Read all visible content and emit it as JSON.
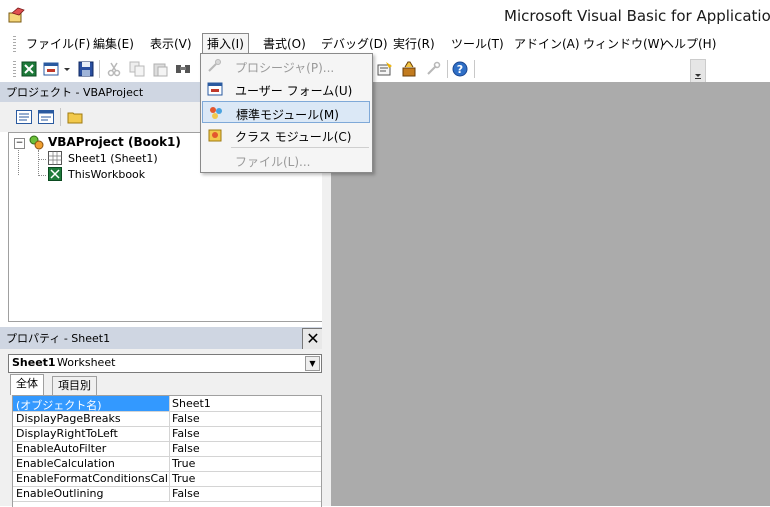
{
  "window": {
    "title": "Microsoft Visual Basic for Applications",
    "app_icon": "vba-window-icon"
  },
  "menu": [
    {
      "label": "ファイル(F)"
    },
    {
      "label": "編集(E)"
    },
    {
      "label": "表示(V)"
    },
    {
      "label": "挿入(I)",
      "open": true
    },
    {
      "label": "書式(O)"
    },
    {
      "label": "デバッグ(D)"
    },
    {
      "label": "実行(R)"
    },
    {
      "label": "ツール(T)"
    },
    {
      "label": "アドイン(A)"
    },
    {
      "label": "ウィンドウ(W)"
    },
    {
      "label": "ヘルプ(H)"
    }
  ],
  "insert_menu": {
    "items": [
      {
        "label": "プロシージャ(P)...",
        "enabled": false,
        "icon": "procedure-icon"
      },
      {
        "label": "ユーザー フォーム(U)",
        "enabled": true,
        "icon": "userform-icon"
      },
      {
        "label": "標準モジュール(M)",
        "enabled": true,
        "highlighted": true,
        "icon": "standard-module-icon"
      },
      {
        "label": "クラス モジュール(C)",
        "enabled": true,
        "icon": "class-module-icon"
      },
      {
        "label": "ファイル(L)...",
        "enabled": false
      }
    ]
  },
  "toolbar": {
    "icons": [
      "excel-view-icon",
      "insert-userform-icon",
      "dropdown-arrow-icon",
      "save-icon",
      "cut-icon",
      "copy-icon",
      "paste-icon",
      "find-icon",
      "properties-icon",
      "toolbox-icon",
      "tools-icon",
      "help-icon"
    ]
  },
  "project": {
    "title": "プロジェクト - VBAProject",
    "toolbar_icons": [
      "view-code-icon",
      "view-object-icon",
      "toggle-folders-icon"
    ],
    "tree": {
      "root": "VBAProject (Book1)",
      "children": [
        "Sheet1 (Sheet1)",
        "ThisWorkbook"
      ]
    }
  },
  "properties": {
    "title": "プロパティ - Sheet1",
    "close_label": "✕",
    "object_name": "Sheet1",
    "object_type": "Worksheet",
    "tabs": [
      "全体",
      "項目別"
    ],
    "rows": [
      {
        "name": "(オブジェクト名)",
        "value": "Sheet1",
        "selected": true
      },
      {
        "name": "DisplayPageBreaks",
        "value": "False"
      },
      {
        "name": "DisplayRightToLeft",
        "value": "False"
      },
      {
        "name": "EnableAutoFilter",
        "value": "False"
      },
      {
        "name": "EnableCalculation",
        "value": "True"
      },
      {
        "name": "EnableFormatConditionsCalcu",
        "value": "True"
      },
      {
        "name": "EnableOutlining",
        "value": "False"
      }
    ]
  },
  "colors": {
    "pane_header": "#cfd6e2",
    "workspace": "#ababab",
    "selection": "#3399ff",
    "menu_highlight": "#dbe8f6"
  }
}
